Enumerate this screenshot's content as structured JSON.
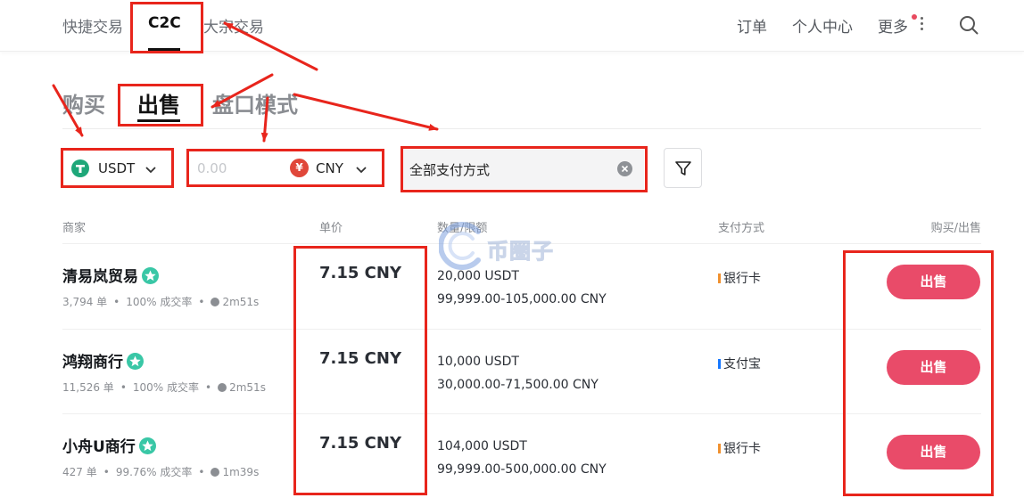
{
  "topnav": {
    "tabs": [
      "快捷交易",
      "C2C",
      "大宗交易"
    ],
    "right": [
      "订单",
      "个人中心",
      "更多"
    ]
  },
  "mode_tabs": [
    "购买",
    "出售",
    "盘口模式"
  ],
  "filters": {
    "coin": "USDT",
    "amount_placeholder": "0.00",
    "currency": "CNY",
    "payment": "全部支付方式"
  },
  "table": {
    "headers": [
      "商家",
      "单价",
      "数量/限额",
      "支付方式",
      "购买/出售"
    ],
    "rows": [
      {
        "merchant": "清易岚贸易",
        "orders": "3,794 单",
        "rate": "100% 成交率",
        "time": "2m51s",
        "price": "7.15 CNY",
        "quantity": "20,000 USDT",
        "limit": "99,999.00-105,000.00 CNY",
        "payment": "银行卡",
        "payment_color": "#f0902e",
        "action": "出售"
      },
      {
        "merchant": "鸿翔商行",
        "orders": "11,526 单",
        "rate": "100% 成交率",
        "time": "2m51s",
        "price": "7.15 CNY",
        "quantity": "10,000 USDT",
        "limit": "30,000.00-71,500.00 CNY",
        "payment": "支付宝",
        "payment_color": "#1677ff",
        "action": "出售"
      },
      {
        "merchant": "小舟U商行",
        "orders": "427 单",
        "rate": "99.76% 成交率",
        "time": "1m39s",
        "price": "7.15 CNY",
        "quantity": "104,000 USDT",
        "limit": "99,999.00-500,000.00 CNY",
        "payment": "银行卡",
        "payment_color": "#f0902e",
        "action": "出售"
      }
    ]
  },
  "watermark": "币圈子",
  "colors": {
    "accent": "#e94b69",
    "annotation": "#e8251c",
    "verified": "#39c7a6",
    "tether": "#1ea779"
  }
}
